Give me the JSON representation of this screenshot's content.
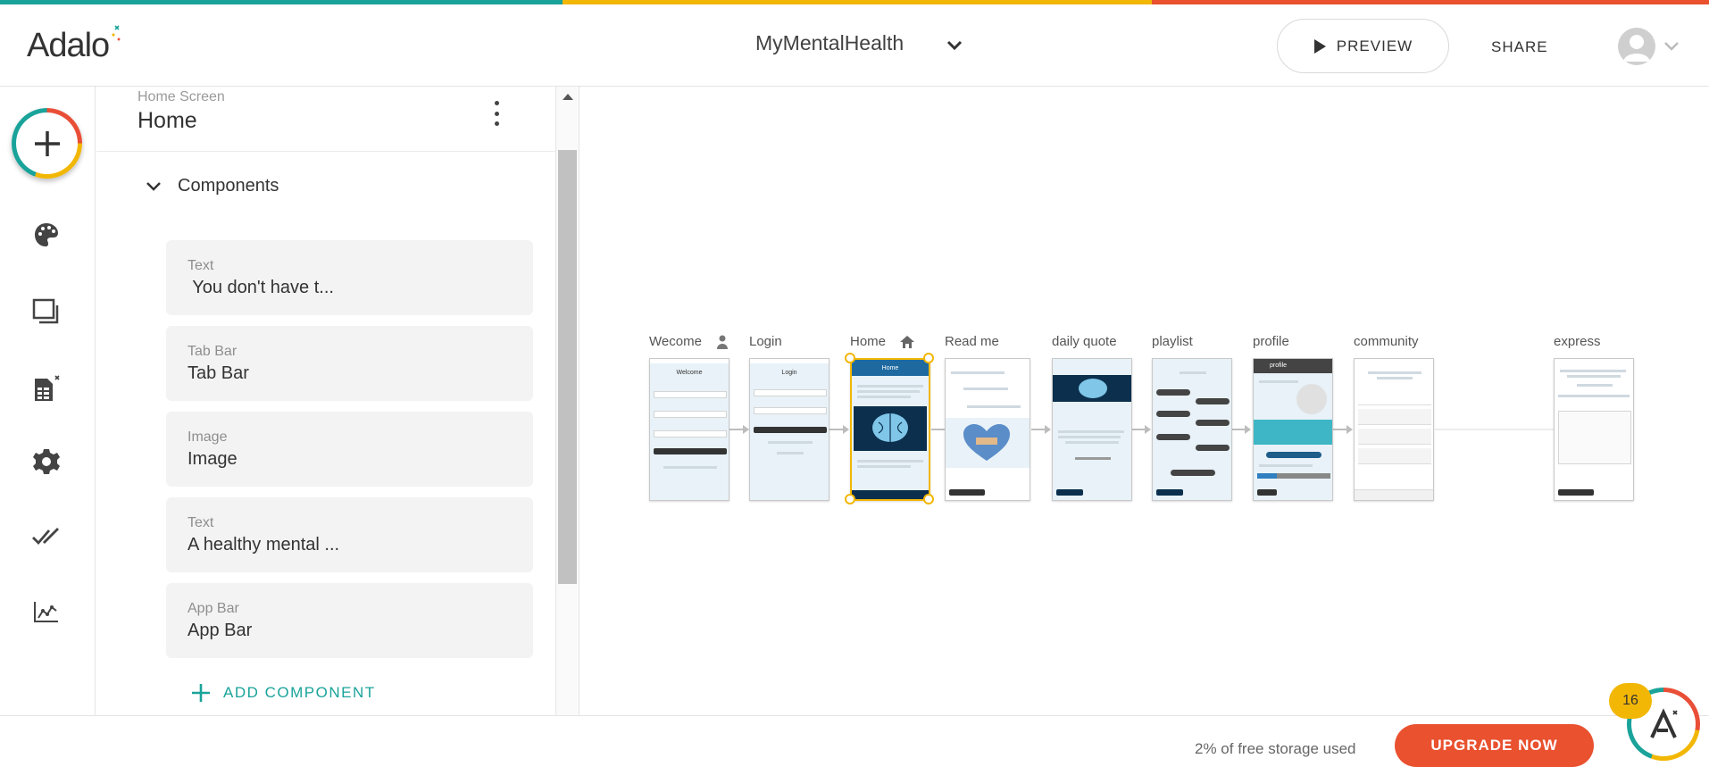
{
  "colors": {
    "teal": "#1aa39a",
    "yellow": "#f2b705",
    "orange": "#e9512f",
    "text": "#333333"
  },
  "header": {
    "logo_text": "Adalo",
    "app_name": "MyMentalHealth",
    "preview_label": "PREVIEW",
    "share_label": "SHARE"
  },
  "rail": {
    "items": [
      "add-icon",
      "palette-icon",
      "screens-icon",
      "database-icon",
      "settings-icon",
      "publish-icon",
      "analytics-icon"
    ]
  },
  "panel": {
    "screen_kicker": "Home Screen",
    "screen_name": "Home",
    "components_label": "Components",
    "components": [
      {
        "kind": "Text",
        "name": " You don't have t..."
      },
      {
        "kind": "Tab Bar",
        "name": "Tab Bar"
      },
      {
        "kind": "Image",
        "name": "Image"
      },
      {
        "kind": "Text",
        "name": "A healthy mental ..."
      },
      {
        "kind": "App Bar",
        "name": "App Bar"
      }
    ],
    "add_component_label": "ADD COMPONENT"
  },
  "canvas": {
    "screens": [
      {
        "label": "Wecome",
        "title": "Welcome",
        "icon": "user-icon"
      },
      {
        "label": "Login",
        "title": "Login"
      },
      {
        "label": "Home",
        "title": "Home",
        "icon": "home-icon",
        "selected": true
      },
      {
        "label": "Read me",
        "title": ""
      },
      {
        "label": "daily quote",
        "title": ""
      },
      {
        "label": "playlist",
        "title": ""
      },
      {
        "label": "profile",
        "title": "profile"
      },
      {
        "label": "community",
        "title": ""
      },
      {
        "label": "express",
        "title": ""
      }
    ]
  },
  "footer": {
    "storage_text": "2% of free storage used",
    "upgrade_label": "UPGRADE NOW",
    "assist_badge": "16"
  }
}
